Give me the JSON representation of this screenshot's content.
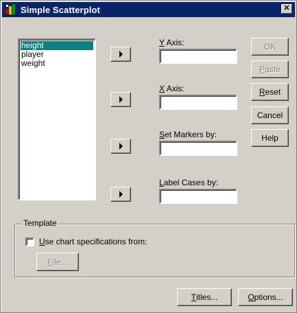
{
  "window": {
    "title": "Simple Scatterplot",
    "close_glyph": "✕"
  },
  "variables": {
    "items": [
      "height",
      "player",
      "weight"
    ],
    "selected_index": 0
  },
  "fields": {
    "y_axis": {
      "label_accel": "Y",
      "label_rest": " Axis:",
      "value": ""
    },
    "x_axis": {
      "label_accel": "X",
      "label_rest": " Axis:",
      "value": ""
    },
    "set_markers": {
      "label_accel": "S",
      "label_rest": "et Markers by:",
      "value": ""
    },
    "label_cases": {
      "label_accel": "L",
      "label_rest": "abel Cases by:",
      "value": ""
    }
  },
  "buttons": {
    "ok": "OK",
    "paste_accel": "P",
    "paste_rest": "aste",
    "reset_accel": "R",
    "reset_rest": "eset",
    "cancel": "Cancel",
    "help": "Help",
    "titles_accel": "T",
    "titles_rest": "itles...",
    "options_accel": "O",
    "options_rest": "ptions..."
  },
  "template": {
    "legend": "Template",
    "checkbox_accel": "U",
    "checkbox_rest": "se chart specifications from:",
    "checked": false,
    "file_accel": "F",
    "file_rest": "ile..."
  },
  "colors": {
    "titlebar": "#0a246a",
    "selection": "#0a8080",
    "face": "#d4d0c8"
  }
}
